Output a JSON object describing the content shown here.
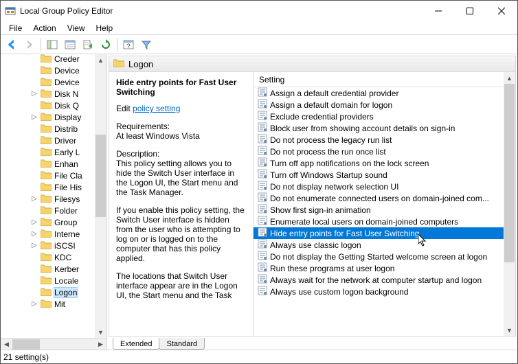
{
  "window": {
    "title": "Local Group Policy Editor"
  },
  "menu": {
    "items": [
      "File",
      "Action",
      "View",
      "Help"
    ]
  },
  "toolbar": {
    "back": "back-arrow-icon",
    "forward": "forward-arrow-icon",
    "up": "up-folder-icon",
    "props": "properties-icon",
    "export": "export-list-icon",
    "refresh": "refresh-icon",
    "help": "help-icon",
    "options": "options-icon",
    "filter": "filter-icon"
  },
  "tree": {
    "items": [
      {
        "label": "Creder",
        "expandable": false
      },
      {
        "label": "Device",
        "expandable": false
      },
      {
        "label": "Device",
        "expandable": false
      },
      {
        "label": "Disk N",
        "expandable": true
      },
      {
        "label": "Disk Q",
        "expandable": false
      },
      {
        "label": "Display",
        "expandable": true
      },
      {
        "label": "Distrib",
        "expandable": false
      },
      {
        "label": "Driver",
        "expandable": false
      },
      {
        "label": "Early L",
        "expandable": false
      },
      {
        "label": "Enhan",
        "expandable": false
      },
      {
        "label": "File Cla",
        "expandable": false
      },
      {
        "label": "File His",
        "expandable": false
      },
      {
        "label": "Filesys",
        "expandable": true
      },
      {
        "label": "Folder",
        "expandable": false
      },
      {
        "label": "Group",
        "expandable": true
      },
      {
        "label": "Interne",
        "expandable": true
      },
      {
        "label": "iSCSI",
        "expandable": true
      },
      {
        "label": "KDC",
        "expandable": false
      },
      {
        "label": "Kerber",
        "expandable": false
      },
      {
        "label": "Locale",
        "expandable": false
      },
      {
        "label": "Logon",
        "expandable": false,
        "selected": true
      },
      {
        "label": "Mit",
        "expandable": true
      }
    ]
  },
  "node": {
    "title": "Logon"
  },
  "desc": {
    "name": "Hide entry points for Fast User Switching",
    "editPrefix": "Edit ",
    "editLink": "policy setting",
    "reqLabel": "Requirements:",
    "reqText": "At least Windows Vista",
    "descLabel": "Description:",
    "descText1": "This policy setting allows you to hide the Switch User interface in the Logon UI, the Start menu and the Task Manager.",
    "descText2": "If you enable this policy setting, the Switch User interface is hidden from the user who is attempting to log on or is logged on to the computer that has this policy applied.",
    "descText3": "The locations that Switch User interface appear are in the Logon UI, the Start menu and the Task"
  },
  "list": {
    "header": "Setting",
    "items": [
      "Assign a default credential provider",
      "Assign a default domain for logon",
      "Exclude credential providers",
      "Block user from showing account details on sign-in",
      "Do not process the legacy run list",
      "Do not process the run once list",
      "Turn off app notifications on the lock screen",
      "Turn off Windows Startup sound",
      "Do not display network selection UI",
      "Do not enumerate connected users on domain-joined com...",
      "Show first sign-in animation",
      "Enumerate local users on domain-joined computers",
      "Hide entry points for Fast User Switching",
      "Always use classic logon",
      "Do not display the Getting Started welcome screen at logon",
      "Run these programs at user logon",
      "Always wait for the network at computer startup and logon",
      "Always use custom logon background"
    ],
    "selectedIndex": 12
  },
  "tabs": {
    "extended": "Extended",
    "standard": "Standard"
  },
  "status": {
    "text": "21 setting(s)"
  }
}
